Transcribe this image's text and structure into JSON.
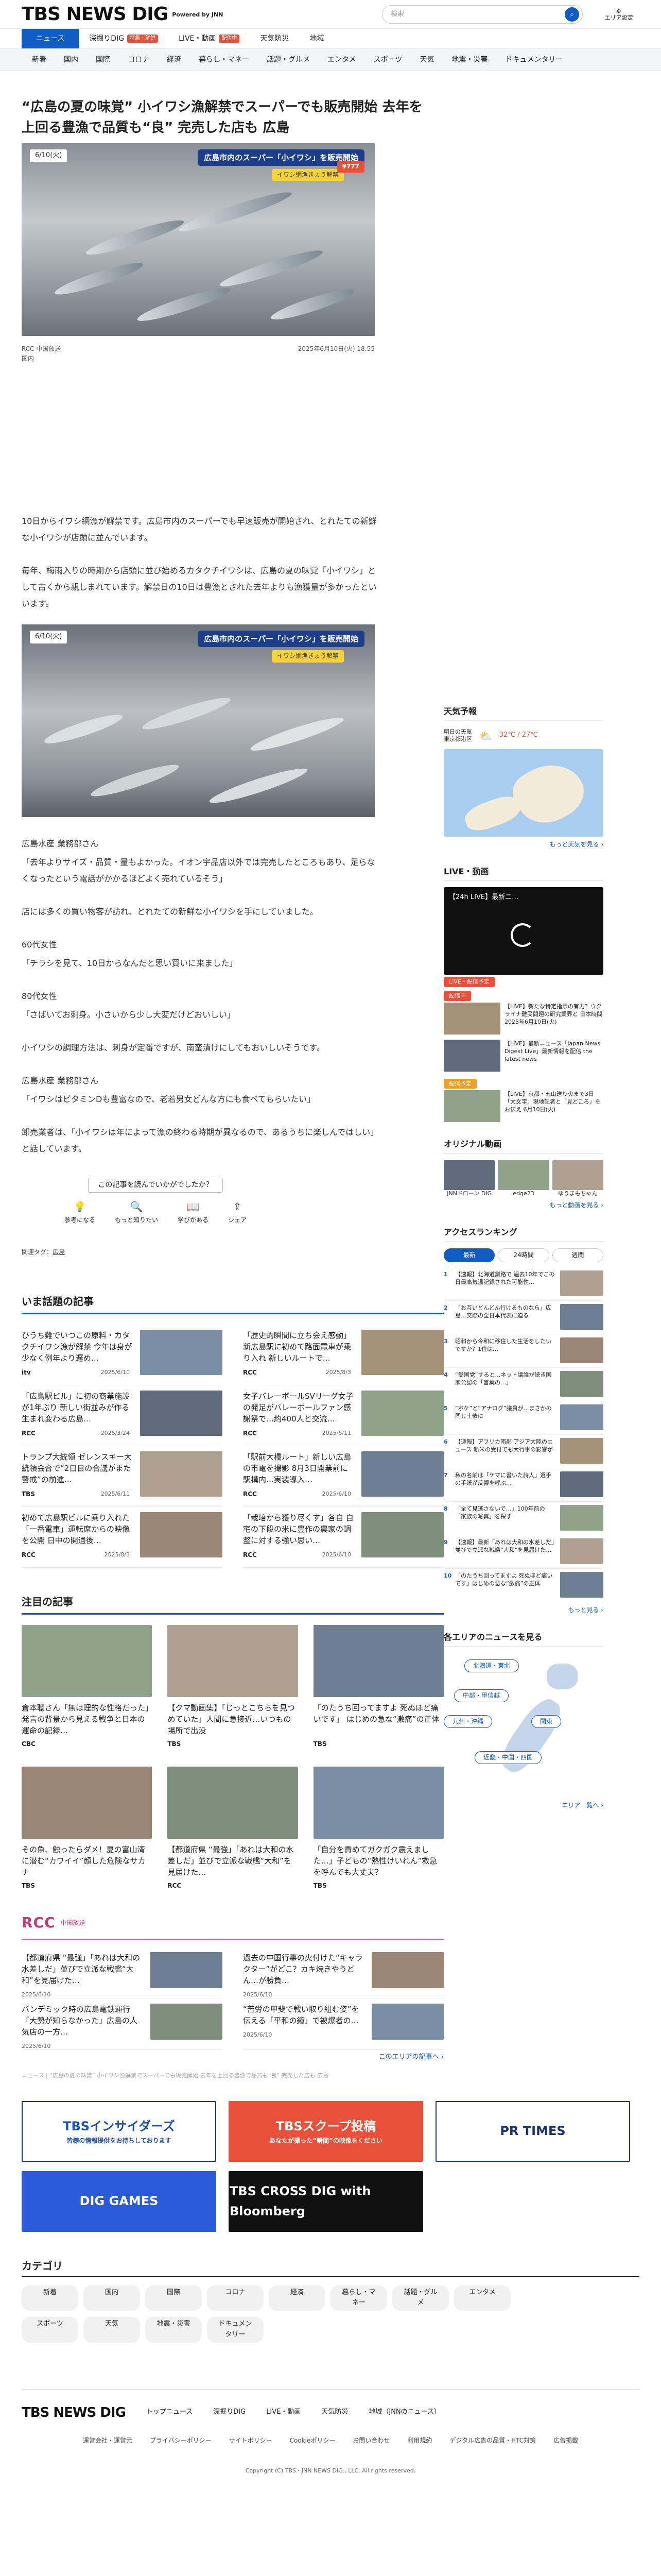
{
  "header": {
    "logo": "TBS NEWS DIG",
    "logo_sub": "Powered by JNN",
    "search_placeholder": "検索",
    "area_label": "エリア設定"
  },
  "nav1": [
    {
      "label": "ニュース",
      "on": true
    },
    {
      "label": "深掘りDIG",
      "badge": "特集・解説",
      "badge_color": "#e8503a"
    },
    {
      "label": "LIVE・動画",
      "badge": "配信中",
      "badge_color": "#e8503a"
    },
    {
      "label": "天気防災"
    },
    {
      "label": "地域"
    }
  ],
  "nav2": [
    "新着",
    "国内",
    "国際",
    "コロナ",
    "経済",
    "暮らし・マネー",
    "話題・グルメ",
    "エンタメ",
    "スポーツ",
    "天気",
    "地震・災害",
    "ドキュメンタリー"
  ],
  "article": {
    "title": "“広島の夏の味覚” 小イワシ漁解禁でスーパーでも販売開始 去年を上回る豊漁で品質も“良” 完売した店も 広島",
    "hero_date": "6/10(火)",
    "hero_caption": "広島市内のスーパー「小イワシ」を販売開始",
    "hero_sub": "イワシ網漁きょう解禁",
    "hero_price": "¥777",
    "source": "RCC 中国放送",
    "date": "2025年6月10日(火) 18:55",
    "more": "国内",
    "p1": "10日からイワシ網漁が解禁です。広島市内のスーパーでも早速販売が開始され、とれたての新鮮な小イワシが店頭に並んでいます。",
    "p2": "毎年、梅雨入りの時期から店頭に並び始めるカタクチイワシは、広島の夏の味覚「小イワシ」として古くから親しまれています。解禁日の10日は豊漁とされた去年よりも漁獲量が多かったといいます。",
    "fig_date": "6/10(火)",
    "fig_caption": "広島市内のスーパー「小イワシ」を販売開始",
    "fig_sub": "イワシ網漁きょう解禁",
    "p3a": "広島水産 業務部さん",
    "p3b": "「去年よりサイズ・品質・量もよかった。イオン宇品店以外では完売したところもあり、足らなくなったという電話がかかるほどよく売れているそう」",
    "p4": "店には多くの買い物客が訪れ、とれたての新鮮な小イワシを手にしていました。",
    "p5a": "60代女性",
    "p5b": "「チラシを見て、10日からなんだと思い買いに来ました」",
    "p6a": "80代女性",
    "p6b": "「さばいてお刺身。小さいから少し大変だけどおいしい」",
    "p7": "小イワシの調理方法は、刺身が定番ですが、南蛮漬けにしてもおいしいそうです。",
    "p8a": "広島水産 業務部さん",
    "p8b": "「イワシはビタミンDも豊富なので、老若男女どんな方にも食べてもらいたい」",
    "p9": "卸売業者は、「小イワシは年によって漁の終わる時期が異なるので、あるうちに楽しんではしい」と話しています。",
    "react_q": "この記事を読んでいかがでしたか？",
    "react": [
      {
        "icon": "lightbulb-icon",
        "glyph": "💡",
        "label": "参考になる"
      },
      {
        "icon": "search-icon",
        "glyph": "🔍",
        "label": "もっと知りたい"
      },
      {
        "icon": "book-icon",
        "glyph": "📖",
        "label": "学びがある"
      },
      {
        "icon": "share-icon",
        "glyph": "⇪",
        "label": "シェア"
      }
    ],
    "tags_label": "関連タグ：",
    "tag": "広島"
  },
  "trending": {
    "title": "いま話題の記事",
    "items": [
      {
        "t": "ひうち難でいつこの原料・カタクチイワシ漁が解禁 今年は身が少なく例年より遅め…",
        "s": "itv",
        "d": "2025/6/10"
      },
      {
        "t": "「歴史的瞬間に立ち会え感動」新広島駅に初めて路面電車が乗り入れ 新しいルートで…",
        "s": "RCC",
        "d": "2025/8/3"
      },
      {
        "t": "「広島駅ビル」に初の商業施設が1年ぶり 新しい街並みが作る生まれ変わる広島…",
        "s": "RCC",
        "d": "2025/3/24"
      },
      {
        "t": "女子バレーボールSVリーグ女子の発足がバレーボールファン感謝祭で…約400人と交流…",
        "s": "RCC",
        "d": "2025/6/11"
      },
      {
        "t": "トランプ大統領 ゼレンスキー大統領会合で“2日目の合議がまた警戒”の前進…",
        "s": "TBS",
        "d": "2025/6/11"
      },
      {
        "t": "「駅前大橋ルート」新しい広島の市電を撮影 8月3日開業前に駅構内…実装導入…",
        "s": "RCC",
        "d": "2025/6/10"
      },
      {
        "t": "初めて広島駅ビルに乗り入れた「一番電車」運転席からの映像を公開 日中の開通後…",
        "s": "RCC",
        "d": "2025/8/3"
      },
      {
        "t": "「栽培から獲り尽くす」各自 自宅の下段の米に豊作の農家の調整に対する強い思い…",
        "s": "RCC",
        "d": "2025/6/10"
      }
    ]
  },
  "attention": {
    "title": "注目の記事",
    "items": [
      {
        "t": "倉本聰さん「無は理的な性格だった」発言の背景から見える戦争と日本の運命の記録…",
        "s": "CBC",
        "d": ""
      },
      {
        "t": "【クマ動画集】「じっとこちらを見つめていた」人間に急接近…いつもの場所で出没",
        "s": "TBS",
        "d": ""
      },
      {
        "t": "「のたうち回ってますよ 死ぬほど痛いです」 はじめの急な“激痛”の正体",
        "s": "TBS",
        "d": ""
      },
      {
        "t": "その魚、触ったらダメ！夏の富山湾に潜む“カワイイ”顔した危険なサカナ",
        "s": "TBS",
        "d": ""
      },
      {
        "t": "【都道府県 “最強」「あれは大和の水差しだ」並びで立派な戦艦“大和”を見届けた…",
        "s": "RCC",
        "d": ""
      },
      {
        "t": "「自分を責めてガクガク震えました…」子どもの“熱性けいれん”救急を呼んでも大丈夫？",
        "s": "TBS",
        "d": ""
      }
    ]
  },
  "rcc": {
    "logo": "RCC",
    "sub": "中国放送",
    "items": [
      {
        "t": "【都道府県 “最強」「あれは大和の水差しだ」並びで立派な戦艦“大和”を見届けた…",
        "d": "2025/6/10"
      },
      {
        "t": "過去の中国行事の火付けた“キャラクター”がどこ？カキ焼きやうどん…が勝負…",
        "d": "2025/6/10"
      },
      {
        "t": "パンデミック時の広島電鉄運行「大勢が知らなかった」広島の人気店の一方…",
        "d": "2025/6/10"
      },
      {
        "t": "“苦労の甲斐で戦い取り組む姿”を伝える「平和の鐘」で被爆者の…",
        "d": "2025/6/10"
      }
    ],
    "more": "このエリアの記事へ ›"
  },
  "crumb": "ニュース | “広島の夏の味覚” 小イワシ漁解禁でスーパーでも販売開始 去年を上回る豊漁で品質も“良” 完売した店も 広島",
  "banners": [
    {
      "t": "TBSインサイダーズ",
      "sub": "皆様の情報提供をお待ちしております",
      "bg": "#fff",
      "fg": "#1c4fb0"
    },
    {
      "t": "TBSスクープ投稿",
      "sub": "あなたが撮った“瞬間”の映像をください",
      "bg": "#e8503a",
      "fg": "#fff"
    },
    {
      "t": "PR TIMES",
      "sub": "",
      "bg": "#fff",
      "fg": "#16337a"
    },
    {
      "t": "DIG GAMES",
      "sub": "",
      "bg": "#2b5bd7",
      "fg": "#fff"
    },
    {
      "t": "TBS CROSS DIG with Bloomberg",
      "sub": "",
      "bg": "#111",
      "fg": "#fff"
    }
  ],
  "category": {
    "title": "カテゴリ",
    "chips": [
      "新着",
      "国内",
      "国際",
      "コロナ",
      "経済",
      "暮らし・マネー",
      "話題・グルメ",
      "エンタメ",
      "スポーツ",
      "天気",
      "地震・災害",
      "ドキュメンタリー"
    ]
  },
  "footer": {
    "links1": [
      "トップニュース",
      "深掘りDIG",
      "LIVE・動画",
      "天気防災",
      "地域（JNNのニュース）"
    ],
    "links2": [
      "運営会社・運営元",
      "プライバシーポリシー",
      "サイトポリシー",
      "Cookieポリシー",
      "お問い合わせ",
      "利用規約",
      "デジタル広告の品質・HTC対策",
      "広告掲載"
    ],
    "copy": "Copyright (C) TBS・JNN NEWS DIG., LLC. All rights reserved."
  },
  "side": {
    "weather": {
      "title": "天気予報",
      "city": "東京都港区",
      "label": "明日の天気",
      "temp": "32℃ / 27℃",
      "more": "もっと天気を見る ›"
    },
    "live": {
      "title": "LIVE・動画",
      "vid": "【24h LIVE】最新ニ…",
      "pill1": "LIVE・配信予定",
      "pill2": "配信中",
      "pill3": "配信予定",
      "items": [
        {
          "t": "【LIVE】新たな特定指示の有力？ウクライナ難民問題の研究業界と 日本時間2025年6月10日(火)"
        },
        {
          "t": "【LIVE】最新ニュース「Japan News Digest Live」最新情報を配信 the latest news"
        },
        {
          "t": "【LIVE】京都・五山送り火まで3日「大文字」現地記者と「見どころ」をお伝え 6月10日(火)"
        }
      ]
    },
    "orig": {
      "title": "オリジナル動画",
      "items": [
        "JNNドローン DIG",
        "edge23",
        "ゆりまもちゃん"
      ],
      "more": "もっと動画を見る ›"
    },
    "rank": {
      "title": "アクセスランキング",
      "tabs": [
        "最新",
        "24時間",
        "週間"
      ],
      "items": [
        "【速報】北海道釧路で 過去10年でこの日最高気温記録された可能性…",
        "「お互いどんどん行けるものなら」広島…交際の全日本代表に迫る",
        "昭和から令和に移住した生活をしたいですか？1位は…",
        "“愛国党”すると…ネット議論が続き国家公認の「言葉の…」",
        "“ボケ”と“アナログ”議員が…まさかの同じ土俵に",
        "【速報】アフリカ南部 アジア大陸のニュース 新米の受付でも大行事の影響が",
        "私の名前は「ケマに書いた詩人」選手の手紙が反響を呼ぶ…",
        "「全て見逃さないで…」100年前の「家族の写真」を探す",
        "【速報】最新「あれは大和の水差しだ」並びで立派な戦艦“大和”を見届けた…",
        "「のたうち回ってますよ 死ぬほど痛いです」はじめの急な“激痛”の正体"
      ],
      "more": "もっと見る ›"
    },
    "regions": {
      "title": "各エリアのニュースを見る",
      "items": [
        "北海道・東北",
        "中部・甲信越",
        "九州・沖縄",
        "関東",
        "近畿・中国・四国"
      ],
      "more": "エリア一覧へ ›"
    }
  }
}
